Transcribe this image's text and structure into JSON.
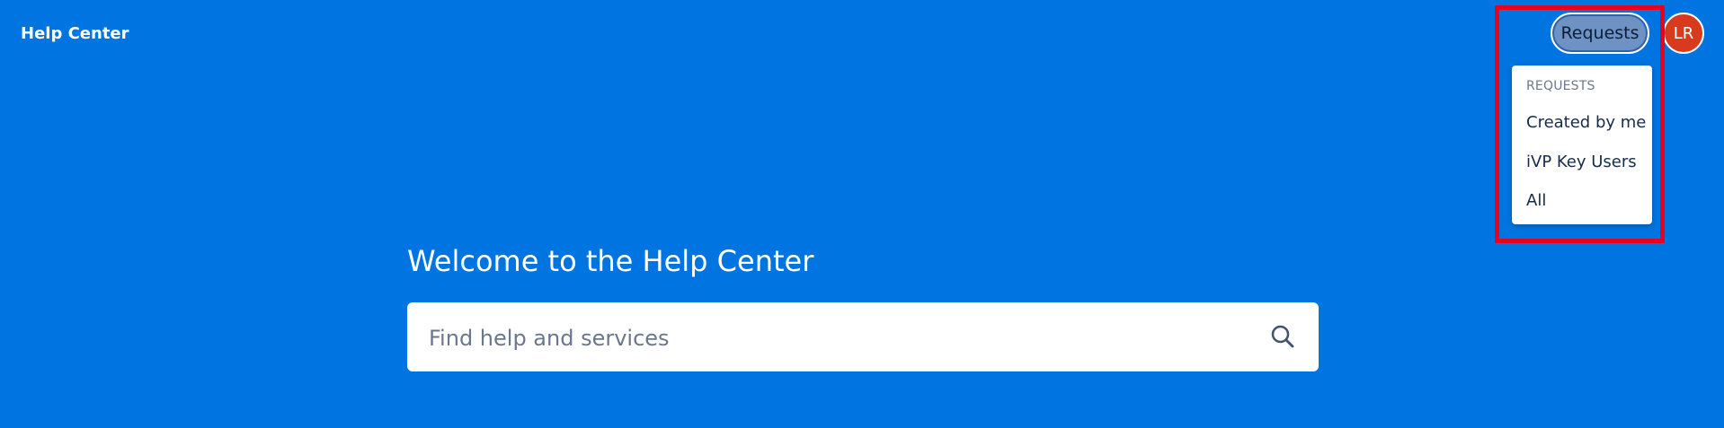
{
  "header": {
    "brand": "Help Center",
    "requests_button": "Requests",
    "avatar_initials": "LR"
  },
  "requests_menu": {
    "heading": "REQUESTS",
    "items": [
      {
        "label": "Created by me"
      },
      {
        "label": "iVP Key Users"
      },
      {
        "label": "All"
      }
    ]
  },
  "hero": {
    "title": "Welcome to the Help Center",
    "search_placeholder": "Find help and services"
  },
  "colors": {
    "background": "#0074e0",
    "highlight": "#e8001c",
    "avatar": "#d93a1e"
  },
  "icons": {
    "search": "search-icon"
  }
}
